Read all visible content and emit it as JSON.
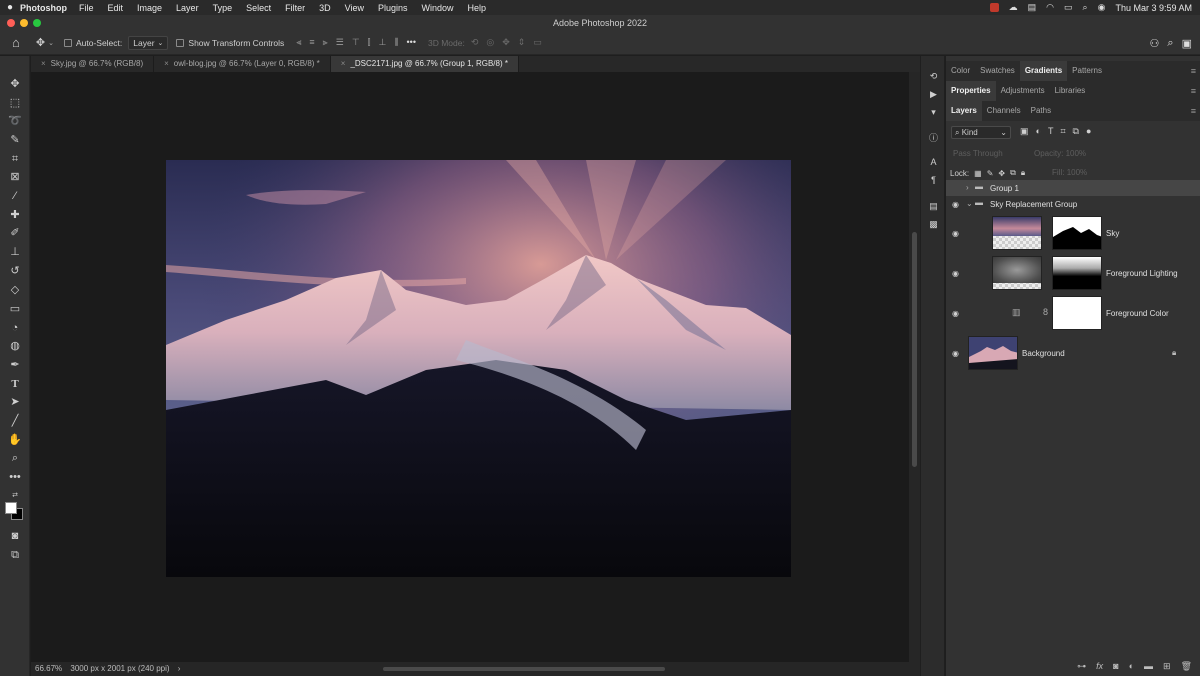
{
  "menubar": {
    "app_name": "Photoshop",
    "items": [
      "File",
      "Edit",
      "Image",
      "Layer",
      "Type",
      "Select",
      "Filter",
      "3D",
      "View",
      "Plugins",
      "Window",
      "Help"
    ],
    "datetime": "Thu Mar 3  9:59 AM"
  },
  "window": {
    "title": "Adobe Photoshop 2022"
  },
  "options": {
    "auto_select_label": "Auto-Select:",
    "auto_select_value": "Layer",
    "transform_label": "Show Transform Controls",
    "mode_3d_label": "3D Mode:"
  },
  "tabs": [
    {
      "label": "Sky.jpg @ 66.7% (RGB/8)",
      "active": false
    },
    {
      "label": "owl-blog.jpg @ 66.7% (Layer 0, RGB/8) *",
      "active": false
    },
    {
      "label": "_DSC2171.jpg @ 66.7% (Group 1, RGB/8) *",
      "active": true
    }
  ],
  "status": {
    "zoom": "66.67%",
    "doc_info": "3000 px x 2001 px (240 ppi)"
  },
  "panels": {
    "tabs_row1": [
      "Color",
      "Swatches",
      "Gradients",
      "Patterns"
    ],
    "tabs_row1_active": "Gradients",
    "tabs_row2": [
      "Properties",
      "Adjustments",
      "Libraries"
    ],
    "tabs_row2_active": "Properties",
    "tabs_row3": [
      "Layers",
      "Channels",
      "Paths"
    ],
    "tabs_row3_active": "Layers"
  },
  "layers_panel": {
    "kind_label": "Kind",
    "blend_mode": "Pass Through",
    "opacity_label": "Opacity:",
    "opacity_value": "100%",
    "lock_label": "Lock:",
    "fill_label": "Fill:",
    "fill_value": "100%",
    "layers": [
      {
        "name": "Group 1"
      },
      {
        "name": "Sky Replacement Group"
      },
      {
        "name": "Sky"
      },
      {
        "name": "Foreground Lighting"
      },
      {
        "name": "Foreground Color"
      },
      {
        "name": "Background"
      }
    ]
  },
  "colors": {
    "accent": "#3b82f6",
    "panel_bg": "#323232",
    "canvas_bg": "#1b1b1b"
  }
}
